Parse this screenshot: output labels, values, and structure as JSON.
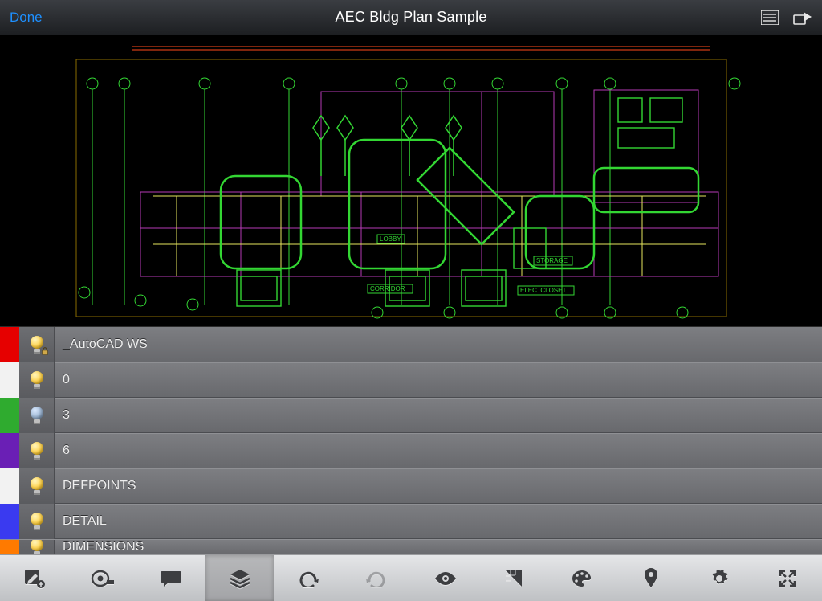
{
  "header": {
    "done_label": "Done",
    "title": "AEC Bldg Plan Sample"
  },
  "canvas": {
    "annotations": [
      "LOBBY",
      "CORRIDOR",
      "STORAGE",
      "ELEC. CLOSET"
    ]
  },
  "layers": [
    {
      "name": "_AutoCAD WS",
      "color": "#e60000",
      "on": true,
      "locked": true
    },
    {
      "name": "0",
      "color": "#f2f2f2",
      "on": true,
      "locked": false
    },
    {
      "name": "3",
      "color": "#2fab2f",
      "on": false,
      "locked": false
    },
    {
      "name": "6",
      "color": "#6a1fb5",
      "on": true,
      "locked": false
    },
    {
      "name": "DEFPOINTS",
      "color": "#f2f2f2",
      "on": true,
      "locked": false
    },
    {
      "name": "DETAIL",
      "color": "#3a3af0",
      "on": true,
      "locked": false
    },
    {
      "name": "DIMENSIONS",
      "color": "#ff7a00",
      "on": true,
      "locked": false
    }
  ],
  "toolbar": {
    "items": [
      {
        "id": "draw",
        "label": "Draw",
        "active": false
      },
      {
        "id": "measure",
        "label": "Measure",
        "active": false
      },
      {
        "id": "text",
        "label": "Text",
        "active": false
      },
      {
        "id": "layers",
        "label": "Layers",
        "active": true
      },
      {
        "id": "undo",
        "label": "Undo",
        "active": false
      },
      {
        "id": "redo",
        "label": "Redo",
        "active": false
      },
      {
        "id": "view",
        "label": "View",
        "active": false
      },
      {
        "id": "snap",
        "label": "Snap",
        "active": false
      },
      {
        "id": "color",
        "label": "Color",
        "active": false
      },
      {
        "id": "location",
        "label": "Location",
        "active": false
      },
      {
        "id": "settings",
        "label": "Settings",
        "active": false
      },
      {
        "id": "fullscreen",
        "label": "Fullscreen",
        "active": false
      }
    ]
  },
  "colors": {
    "accent_link": "#1e90ff",
    "cad_green": "#33d633",
    "cad_yellow": "#e6e65e",
    "cad_magenta": "#b63ab6",
    "cad_orange": "#ff4a1a",
    "cad_grid": "#8a6b00"
  }
}
